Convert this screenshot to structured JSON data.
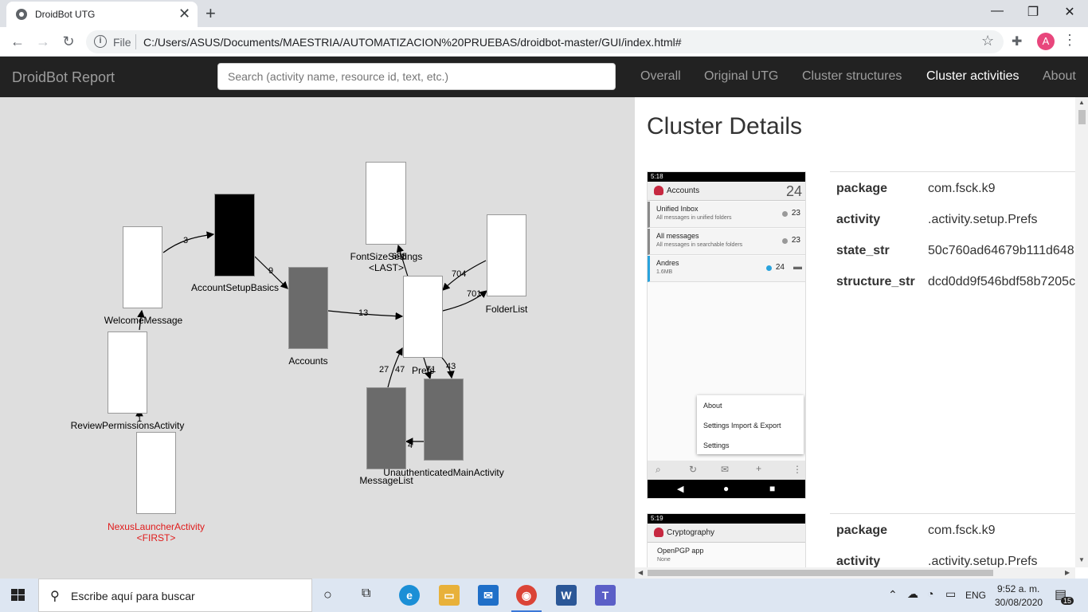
{
  "browser": {
    "tab_title": "DroidBot UTG",
    "new_tab": "+",
    "url_prefix": "File",
    "url": "C:/Users/ASUS/Documents/MAESTRIA/AUTOMATIZACION%20PRUEBAS/droidbot-master/GUI/index.html#",
    "avatar_letter": "A"
  },
  "navbar": {
    "brand": "DroidBot Report",
    "search_placeholder": "Search (activity name, resource id, text, etc.)",
    "links": [
      "Overall",
      "Original UTG",
      "Cluster structures",
      "Cluster activities",
      "About"
    ],
    "active_link": "Cluster activities"
  },
  "graph": {
    "nodes": [
      {
        "label": "NexusLauncherActivity\n<FIRST>",
        "start": true
      },
      {
        "label": "ReviewPermissionsActivity"
      },
      {
        "label": "WelcomeMessage"
      },
      {
        "label": "AccountSetupBasics"
      },
      {
        "label": "Accounts"
      },
      {
        "label": "FontSizeSettings\n<LAST>"
      },
      {
        "label": "Prefs"
      },
      {
        "label": "FolderList"
      },
      {
        "label": "MessageList"
      },
      {
        "label": "UnauthenticatedMainActivity"
      }
    ],
    "edge_labels": [
      "3",
      "9",
      "13",
      "704",
      "701",
      "27",
      "47",
      "71",
      "43",
      "4",
      "698",
      "1"
    ]
  },
  "details": {
    "title": "Cluster Details",
    "states": [
      {
        "screenshot": {
          "time": "5:18",
          "app_title": "Accounts",
          "count": "24",
          "rows": [
            {
              "name": "Unified Inbox",
              "desc": "All messages in unified folders",
              "count": "23"
            },
            {
              "name": "All messages",
              "desc": "All messages in searchable folders",
              "count": "23"
            },
            {
              "name": "Andres",
              "desc": "1.6MB",
              "count": "24"
            }
          ],
          "menu": [
            "About",
            "Settings Import & Export",
            "Settings"
          ]
        },
        "fields": [
          {
            "key": "package",
            "value": "com.fsck.k9"
          },
          {
            "key": "activity",
            "value": ".activity.setup.Prefs"
          },
          {
            "key": "state_str",
            "value": "50c760ad64679b111d648"
          },
          {
            "key": "structure_str",
            "value": "dcd0dd9f546bdf58b7205c"
          }
        ]
      },
      {
        "screenshot": {
          "time": "5:19",
          "app_title": "Cryptography",
          "rows": [
            {
              "name": "OpenPGP app",
              "desc": "None"
            }
          ]
        },
        "fields": [
          {
            "key": "package",
            "value": "com.fsck.k9"
          },
          {
            "key": "activity",
            "value": ".activity.setup.Prefs"
          }
        ]
      }
    ]
  },
  "taskbar": {
    "search_placeholder": "Escribe aquí para buscar",
    "lang": "ENG",
    "time": "9:52 a. m.",
    "date": "30/08/2020",
    "notifications": "15"
  }
}
